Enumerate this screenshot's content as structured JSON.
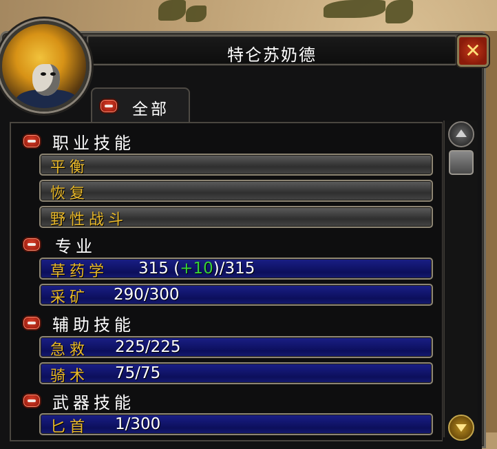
{
  "window": {
    "title": "特仑苏奶德",
    "close_icon": "✕"
  },
  "tab": {
    "label": "全部"
  },
  "categories": [
    {
      "name": "职业技能",
      "skills": [
        {
          "name": "平衡",
          "value": ""
        },
        {
          "name": "恢复",
          "value": ""
        },
        {
          "name": "野性战斗",
          "value": ""
        }
      ]
    },
    {
      "name": "专业",
      "skills": [
        {
          "name": "草药学",
          "value_prefix": "315 (",
          "bonus": "+10",
          "value_suffix": ")/315"
        },
        {
          "name": "采矿",
          "value": "290/300"
        }
      ]
    },
    {
      "name": "辅助技能",
      "skills": [
        {
          "name": "急救",
          "value": "225/225"
        },
        {
          "name": "骑术",
          "value": "75/75"
        }
      ]
    },
    {
      "name": "武器技能",
      "skills": [
        {
          "name": "匕首",
          "value": "1/300"
        }
      ]
    }
  ],
  "colors": {
    "skill_name": "#e8b82a",
    "bonus": "#38d23a",
    "professional_bar": "#0c0f5c",
    "class_bar": "#3a3a3a"
  }
}
